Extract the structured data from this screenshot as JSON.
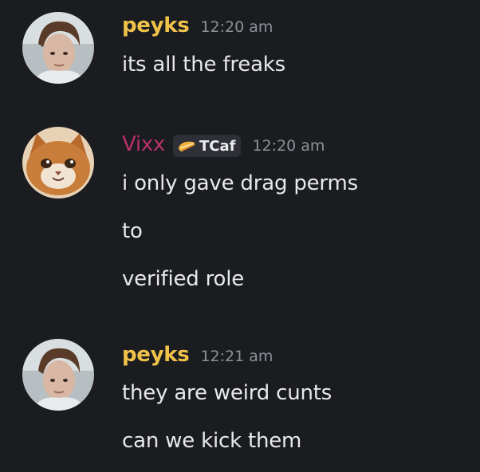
{
  "messages": [
    {
      "username": "peyks",
      "username_color": "#f0c24a",
      "timestamp": "12:20 am",
      "lines": [
        "its all the freaks"
      ]
    },
    {
      "username": "Vixx",
      "username_color": "#b8316b",
      "tag": {
        "label": "TCaf",
        "icon": "sandwich-icon"
      },
      "timestamp": "12:20 am",
      "lines": [
        "i only gave drag perms",
        "to",
        "verified role"
      ]
    },
    {
      "username": "peyks",
      "username_color": "#f0c24a",
      "timestamp": "12:21 am",
      "lines": [
        "they are weird cunts",
        "can we kick them"
      ]
    }
  ],
  "colors": {
    "background": "#1b1c20",
    "message_text": "#e8e9ec",
    "timestamp": "#8e9098",
    "tag_background": "#2f3037"
  }
}
